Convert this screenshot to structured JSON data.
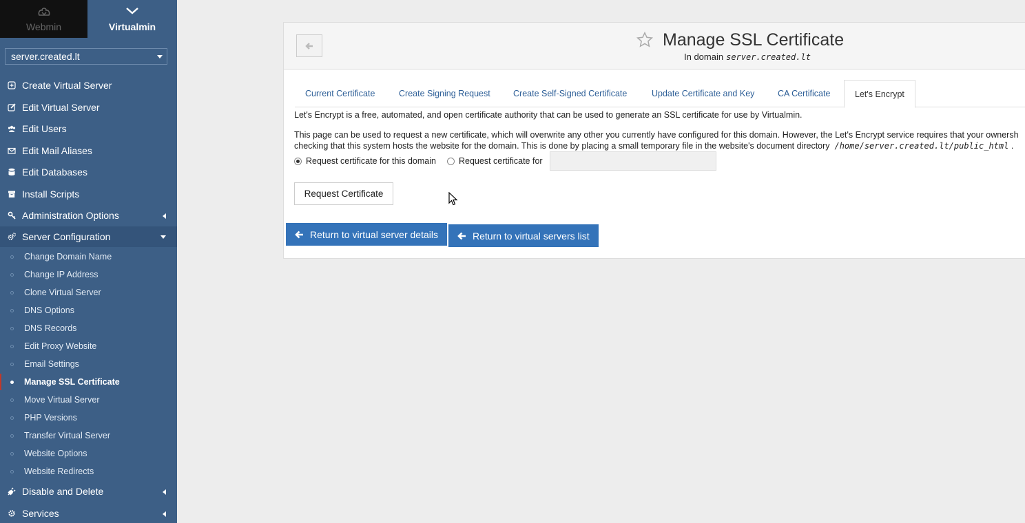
{
  "top": {
    "webmin_label": "Webmin",
    "virtualmin_label": "Virtualmin"
  },
  "domain_select": {
    "value": "server.created.lt"
  },
  "menu": {
    "create_virtual_server": "Create Virtual Server",
    "edit_virtual_server": "Edit Virtual Server",
    "edit_users": "Edit Users",
    "edit_mail_aliases": "Edit Mail Aliases",
    "edit_databases": "Edit Databases",
    "install_scripts": "Install Scripts",
    "administration_options": "Administration Options",
    "server_configuration": "Server Configuration",
    "disable_and_delete": "Disable and Delete",
    "services": "Services"
  },
  "submenu": [
    {
      "label": "Change Domain Name",
      "active": false
    },
    {
      "label": "Change IP Address",
      "active": false
    },
    {
      "label": "Clone Virtual Server",
      "active": false
    },
    {
      "label": "DNS Options",
      "active": false
    },
    {
      "label": "DNS Records",
      "active": false
    },
    {
      "label": "Edit Proxy Website",
      "active": false
    },
    {
      "label": "Email Settings",
      "active": false
    },
    {
      "label": "Manage SSL Certificate",
      "active": true
    },
    {
      "label": "Move Virtual Server",
      "active": false
    },
    {
      "label": "PHP Versions",
      "active": false
    },
    {
      "label": "Transfer Virtual Server",
      "active": false
    },
    {
      "label": "Website Options",
      "active": false
    },
    {
      "label": "Website Redirects",
      "active": false
    }
  ],
  "header": {
    "title": "Manage SSL Certificate",
    "subtitle_prefix": "In domain",
    "subtitle_domain": "server.created.lt"
  },
  "tabs": {
    "current_certificate": "Current Certificate",
    "create_signing_request": "Create Signing Request",
    "create_self_signed": "Create Self-Signed Certificate",
    "update_cert_key": "Update Certificate and Key",
    "ca_certificate": "CA Certificate",
    "lets_encrypt": "Let's Encrypt"
  },
  "content": {
    "intro": "Let's Encrypt is a free, automated, and open certificate authority that can be used to generate an SSL certificate for use by Virtualmin.",
    "para_line1": "This page can be used to request a new certificate, which will overwrite any other you currently have configured for this domain. However, the Let's Encrypt service requires that your ownersh",
    "para_line2_prefix": "checking that this system hosts the website for the domain. This is done by placing a small temporary file in the website's document directory",
    "docroot": "/home/server.created.lt/public_html",
    "para_line2_suffix": ".",
    "radio_this_domain": "Request certificate for this domain",
    "radio_for": "Request certificate for",
    "radio_selected": "this_domain",
    "custom_domains_value": "",
    "request_button": "Request Certificate",
    "return_details": "Return to virtual server details",
    "return_list": "Return to virtual servers list"
  },
  "colors": {
    "sidebar_bg": "#3d5f86",
    "accent_button": "#3473b9",
    "link": "#2b5d96"
  }
}
